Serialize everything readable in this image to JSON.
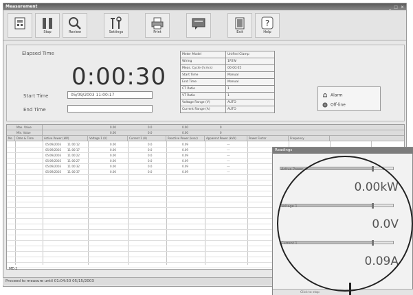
{
  "window": {
    "title": "Measurement",
    "controls": "_ □ ×"
  },
  "toolbar": {
    "buttons": [
      {
        "label": "",
        "icon": "meter-icon"
      },
      {
        "label": "Stop",
        "icon": "stop-icon"
      },
      {
        "label": "Review",
        "icon": "search-icon"
      },
      {
        "label": "Settings",
        "icon": "tools-icon"
      },
      {
        "label": "Print",
        "icon": "print-icon"
      },
      {
        "label": "",
        "icon": "screen-icon"
      },
      {
        "label": "Exit",
        "icon": "exit-icon"
      },
      {
        "label": "Help",
        "icon": "help-icon"
      }
    ]
  },
  "status_panel": {
    "elapsed_label": "Elapsed Time",
    "elapsed_value": "0:00:30",
    "start_label": "Start Time",
    "start_value": "05/09/2003 11:00:17",
    "end_label": "End Time",
    "end_value": ""
  },
  "settings_table": [
    {
      "key": "Meter Model",
      "value": "Unified Clamp"
    },
    {
      "key": "Wiring",
      "value": "1P2W"
    },
    {
      "key": "Meas. Cycle (h:m:s)",
      "value": "00:00:05"
    },
    {
      "key": "Start Time",
      "value": "Manual"
    },
    {
      "key": "End Time",
      "value": "Manual"
    },
    {
      "key": "CT Ratio",
      "value": "1"
    },
    {
      "key": "VT Ratio",
      "value": "1"
    },
    {
      "key": "Voltage Range (V)",
      "value": "AUTO"
    },
    {
      "key": "Current Range (A)",
      "value": "AUTO"
    }
  ],
  "alarms": {
    "alarm_label": "Alarm",
    "off_label": "Off-line"
  },
  "grid": {
    "summary_rows": [
      {
        "label": "Max. Value",
        "cells": [
          "0.00",
          "0.0",
          "0.00",
          "0"
        ]
      },
      {
        "label": "Min. Value",
        "cells": [
          "0.00",
          "0.0",
          "0.00",
          "0"
        ]
      }
    ],
    "columns": [
      "No.",
      "Date & Time",
      "Active Power (kW)",
      "Voltage 1 (V)",
      "Current 1 (A)",
      "Reactive Power (kvar)",
      "Apparent Power (kVA)",
      "Power Factor",
      "Frequency"
    ],
    "rows": [
      {
        "date": "05/09/2003",
        "time": "11:00:12",
        "p": "0.00",
        "v": "0.0",
        "a": "0.09",
        "r": "---"
      },
      {
        "date": "05/09/2003",
        "time": "11:00:17",
        "p": "0.00",
        "v": "0.0",
        "a": "0.09",
        "r": "---"
      },
      {
        "date": "05/09/2003",
        "time": "11:00:22",
        "p": "0.00",
        "v": "0.0",
        "a": "0.09",
        "r": "---"
      },
      {
        "date": "05/09/2003",
        "time": "11:00:27",
        "p": "0.00",
        "v": "0.0",
        "a": "0.09",
        "r": "---"
      },
      {
        "date": "05/09/2003",
        "time": "11:00:32",
        "p": "0.00",
        "v": "0.0",
        "a": "0.09",
        "r": "---"
      },
      {
        "date": "05/09/2003",
        "time": "11:00:37",
        "p": "0.00",
        "v": "0.0",
        "a": "0.09",
        "r": "---"
      }
    ],
    "tab_label": "ME-2"
  },
  "status_bar": {
    "text": "Proceed to measure until 01:04:50 05/15/2003"
  },
  "popup": {
    "title": "Readings",
    "readings": [
      {
        "name": "Active Power",
        "value": "0.00kW",
        "level": 0.82
      },
      {
        "name": "Voltage 1",
        "value": "0.0V",
        "level": 0.82
      },
      {
        "name": "Current 1",
        "value": "0.09A",
        "level": 0.82
      }
    ],
    "footer": "Click to stop"
  }
}
